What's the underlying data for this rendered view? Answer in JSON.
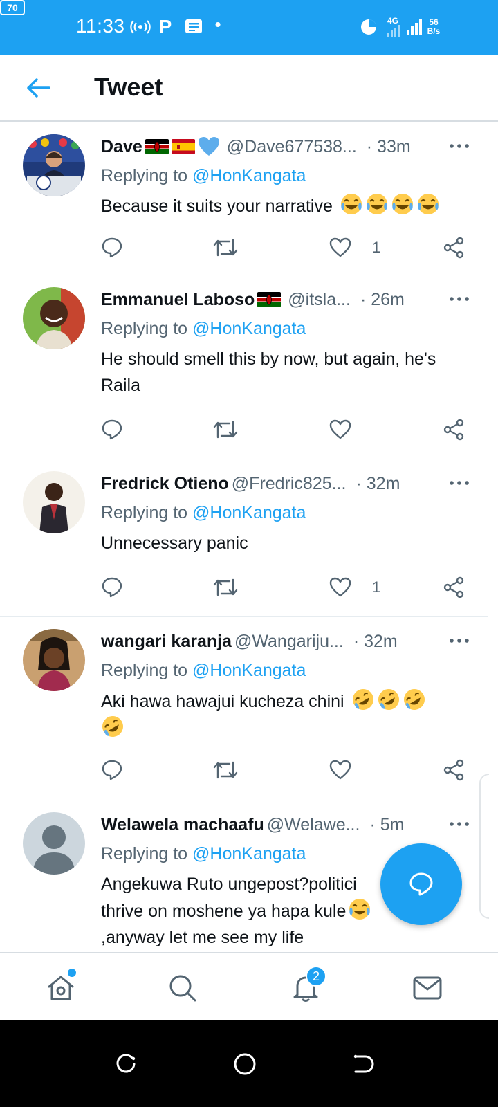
{
  "status_bar": {
    "time": "11:33",
    "p_icon": "P",
    "network_type": "4G",
    "speed_value": "56",
    "speed_unit": "B/s",
    "battery": "70"
  },
  "header": {
    "title": "Tweet",
    "back_icon": "arrow-left-icon"
  },
  "colors": {
    "accent": "#1da1f2",
    "text_primary": "#0f1419",
    "text_secondary": "#536471",
    "divider": "#e6ecf0"
  },
  "tweets": [
    {
      "name": "Dave",
      "flags": [
        "kenya-flag",
        "spain-flag",
        "blue-heart"
      ],
      "handle": "@Dave677538...",
      "time": "· 33m",
      "replying_prefix": "Replying to ",
      "replying_to": "@HonKangata",
      "text": "Because it suits your narrative",
      "emoji": [
        "tears-of-joy",
        "tears-of-joy",
        "tears-of-joy",
        "tears-of-joy"
      ],
      "likes": "1"
    },
    {
      "name": "Emmanuel Laboso",
      "flags": [
        "kenya-flag"
      ],
      "handle": "@itsla...",
      "time": "· 26m",
      "replying_prefix": "Replying to ",
      "replying_to": "@HonKangata",
      "text": "He should smell this by now, but again, he's Raila",
      "emoji": [],
      "likes": ""
    },
    {
      "name": "Fredrick Otieno",
      "flags": [],
      "handle": "@Fredric825...",
      "time": "· 32m",
      "replying_prefix": "Replying to ",
      "replying_to": "@HonKangata",
      "text": "Unnecessary panic",
      "emoji": [],
      "likes": "1"
    },
    {
      "name": "wangari karanja",
      "flags": [],
      "handle": "@Wangariju...",
      "time": "· 32m",
      "replying_prefix": "Replying to ",
      "replying_to": "@HonKangata",
      "text": "Aki hawa hawajui kucheza chini",
      "emoji": [
        "rofl",
        "rofl",
        "rofl",
        "rofl"
      ],
      "likes": ""
    },
    {
      "name": "Welawela machaafu",
      "flags": [],
      "handle": "@Welawe...",
      "time": "· 5m",
      "replying_prefix": "Replying to ",
      "replying_to": "@HonKangata",
      "text_line1": "Angekuwa Ruto ungepost?politici",
      "text_line2": "thrive on moshene ya hapa kule",
      "text_line3": ",anyway let me see my life",
      "emoji": [
        "tears-of-joy"
      ],
      "likes": ""
    }
  ],
  "fab": {
    "icon": "compose-reply-icon"
  },
  "bottom_nav": {
    "items": [
      "home-icon",
      "search-icon",
      "notifications-icon",
      "messages-icon"
    ],
    "notification_count": "2"
  },
  "system_nav": [
    "recents-icon",
    "home-circle-icon",
    "back-icon"
  ]
}
